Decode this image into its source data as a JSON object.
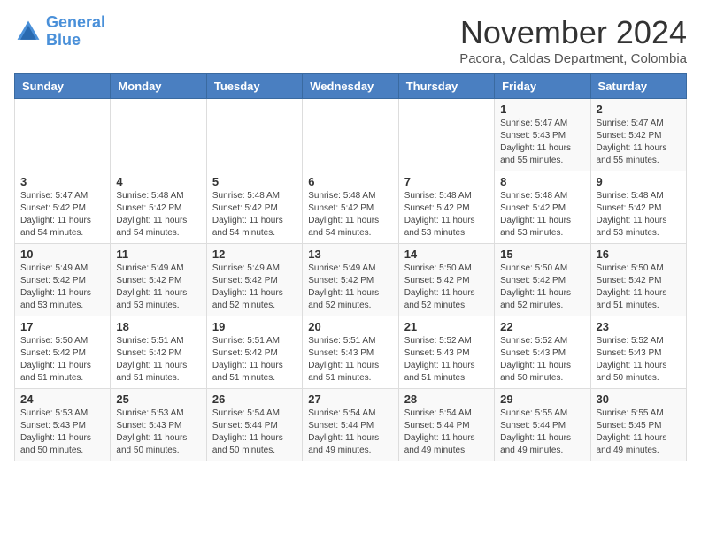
{
  "header": {
    "logo_line1": "General",
    "logo_line2": "Blue",
    "month": "November 2024",
    "location": "Pacora, Caldas Department, Colombia"
  },
  "weekdays": [
    "Sunday",
    "Monday",
    "Tuesday",
    "Wednesday",
    "Thursday",
    "Friday",
    "Saturday"
  ],
  "weeks": [
    [
      {
        "day": "",
        "info": ""
      },
      {
        "day": "",
        "info": ""
      },
      {
        "day": "",
        "info": ""
      },
      {
        "day": "",
        "info": ""
      },
      {
        "day": "",
        "info": ""
      },
      {
        "day": "1",
        "info": "Sunrise: 5:47 AM\nSunset: 5:43 PM\nDaylight: 11 hours\nand 55 minutes."
      },
      {
        "day": "2",
        "info": "Sunrise: 5:47 AM\nSunset: 5:42 PM\nDaylight: 11 hours\nand 55 minutes."
      }
    ],
    [
      {
        "day": "3",
        "info": "Sunrise: 5:47 AM\nSunset: 5:42 PM\nDaylight: 11 hours\nand 54 minutes."
      },
      {
        "day": "4",
        "info": "Sunrise: 5:48 AM\nSunset: 5:42 PM\nDaylight: 11 hours\nand 54 minutes."
      },
      {
        "day": "5",
        "info": "Sunrise: 5:48 AM\nSunset: 5:42 PM\nDaylight: 11 hours\nand 54 minutes."
      },
      {
        "day": "6",
        "info": "Sunrise: 5:48 AM\nSunset: 5:42 PM\nDaylight: 11 hours\nand 54 minutes."
      },
      {
        "day": "7",
        "info": "Sunrise: 5:48 AM\nSunset: 5:42 PM\nDaylight: 11 hours\nand 53 minutes."
      },
      {
        "day": "8",
        "info": "Sunrise: 5:48 AM\nSunset: 5:42 PM\nDaylight: 11 hours\nand 53 minutes."
      },
      {
        "day": "9",
        "info": "Sunrise: 5:48 AM\nSunset: 5:42 PM\nDaylight: 11 hours\nand 53 minutes."
      }
    ],
    [
      {
        "day": "10",
        "info": "Sunrise: 5:49 AM\nSunset: 5:42 PM\nDaylight: 11 hours\nand 53 minutes."
      },
      {
        "day": "11",
        "info": "Sunrise: 5:49 AM\nSunset: 5:42 PM\nDaylight: 11 hours\nand 53 minutes."
      },
      {
        "day": "12",
        "info": "Sunrise: 5:49 AM\nSunset: 5:42 PM\nDaylight: 11 hours\nand 52 minutes."
      },
      {
        "day": "13",
        "info": "Sunrise: 5:49 AM\nSunset: 5:42 PM\nDaylight: 11 hours\nand 52 minutes."
      },
      {
        "day": "14",
        "info": "Sunrise: 5:50 AM\nSunset: 5:42 PM\nDaylight: 11 hours\nand 52 minutes."
      },
      {
        "day": "15",
        "info": "Sunrise: 5:50 AM\nSunset: 5:42 PM\nDaylight: 11 hours\nand 52 minutes."
      },
      {
        "day": "16",
        "info": "Sunrise: 5:50 AM\nSunset: 5:42 PM\nDaylight: 11 hours\nand 51 minutes."
      }
    ],
    [
      {
        "day": "17",
        "info": "Sunrise: 5:50 AM\nSunset: 5:42 PM\nDaylight: 11 hours\nand 51 minutes."
      },
      {
        "day": "18",
        "info": "Sunrise: 5:51 AM\nSunset: 5:42 PM\nDaylight: 11 hours\nand 51 minutes."
      },
      {
        "day": "19",
        "info": "Sunrise: 5:51 AM\nSunset: 5:42 PM\nDaylight: 11 hours\nand 51 minutes."
      },
      {
        "day": "20",
        "info": "Sunrise: 5:51 AM\nSunset: 5:43 PM\nDaylight: 11 hours\nand 51 minutes."
      },
      {
        "day": "21",
        "info": "Sunrise: 5:52 AM\nSunset: 5:43 PM\nDaylight: 11 hours\nand 51 minutes."
      },
      {
        "day": "22",
        "info": "Sunrise: 5:52 AM\nSunset: 5:43 PM\nDaylight: 11 hours\nand 50 minutes."
      },
      {
        "day": "23",
        "info": "Sunrise: 5:52 AM\nSunset: 5:43 PM\nDaylight: 11 hours\nand 50 minutes."
      }
    ],
    [
      {
        "day": "24",
        "info": "Sunrise: 5:53 AM\nSunset: 5:43 PM\nDaylight: 11 hours\nand 50 minutes."
      },
      {
        "day": "25",
        "info": "Sunrise: 5:53 AM\nSunset: 5:43 PM\nDaylight: 11 hours\nand 50 minutes."
      },
      {
        "day": "26",
        "info": "Sunrise: 5:54 AM\nSunset: 5:44 PM\nDaylight: 11 hours\nand 50 minutes."
      },
      {
        "day": "27",
        "info": "Sunrise: 5:54 AM\nSunset: 5:44 PM\nDaylight: 11 hours\nand 49 minutes."
      },
      {
        "day": "28",
        "info": "Sunrise: 5:54 AM\nSunset: 5:44 PM\nDaylight: 11 hours\nand 49 minutes."
      },
      {
        "day": "29",
        "info": "Sunrise: 5:55 AM\nSunset: 5:44 PM\nDaylight: 11 hours\nand 49 minutes."
      },
      {
        "day": "30",
        "info": "Sunrise: 5:55 AM\nSunset: 5:45 PM\nDaylight: 11 hours\nand 49 minutes."
      }
    ]
  ]
}
